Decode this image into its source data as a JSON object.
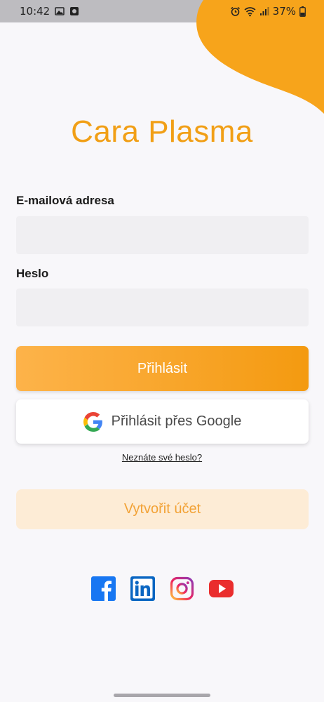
{
  "status_bar": {
    "time": "10:42",
    "battery": "37%",
    "icons": [
      "image-icon",
      "app-notification-icon",
      "alarm-icon",
      "wifi-icon",
      "signal-icon",
      "battery-icon"
    ]
  },
  "brand": {
    "name": "Cara Plasma",
    "accent_color": "#f19f16"
  },
  "form": {
    "email_label": "E-mailová adresa",
    "email_value": "",
    "password_label": "Heslo",
    "password_value": "",
    "login_button": "Přihlásit",
    "google_button": "Přihlásit přes Google",
    "forgot_link": "Neznáte své heslo?",
    "create_account_button": "Vytvořit účet"
  },
  "social": {
    "icons": [
      "facebook-icon",
      "linkedin-icon",
      "instagram-icon",
      "youtube-icon"
    ]
  }
}
